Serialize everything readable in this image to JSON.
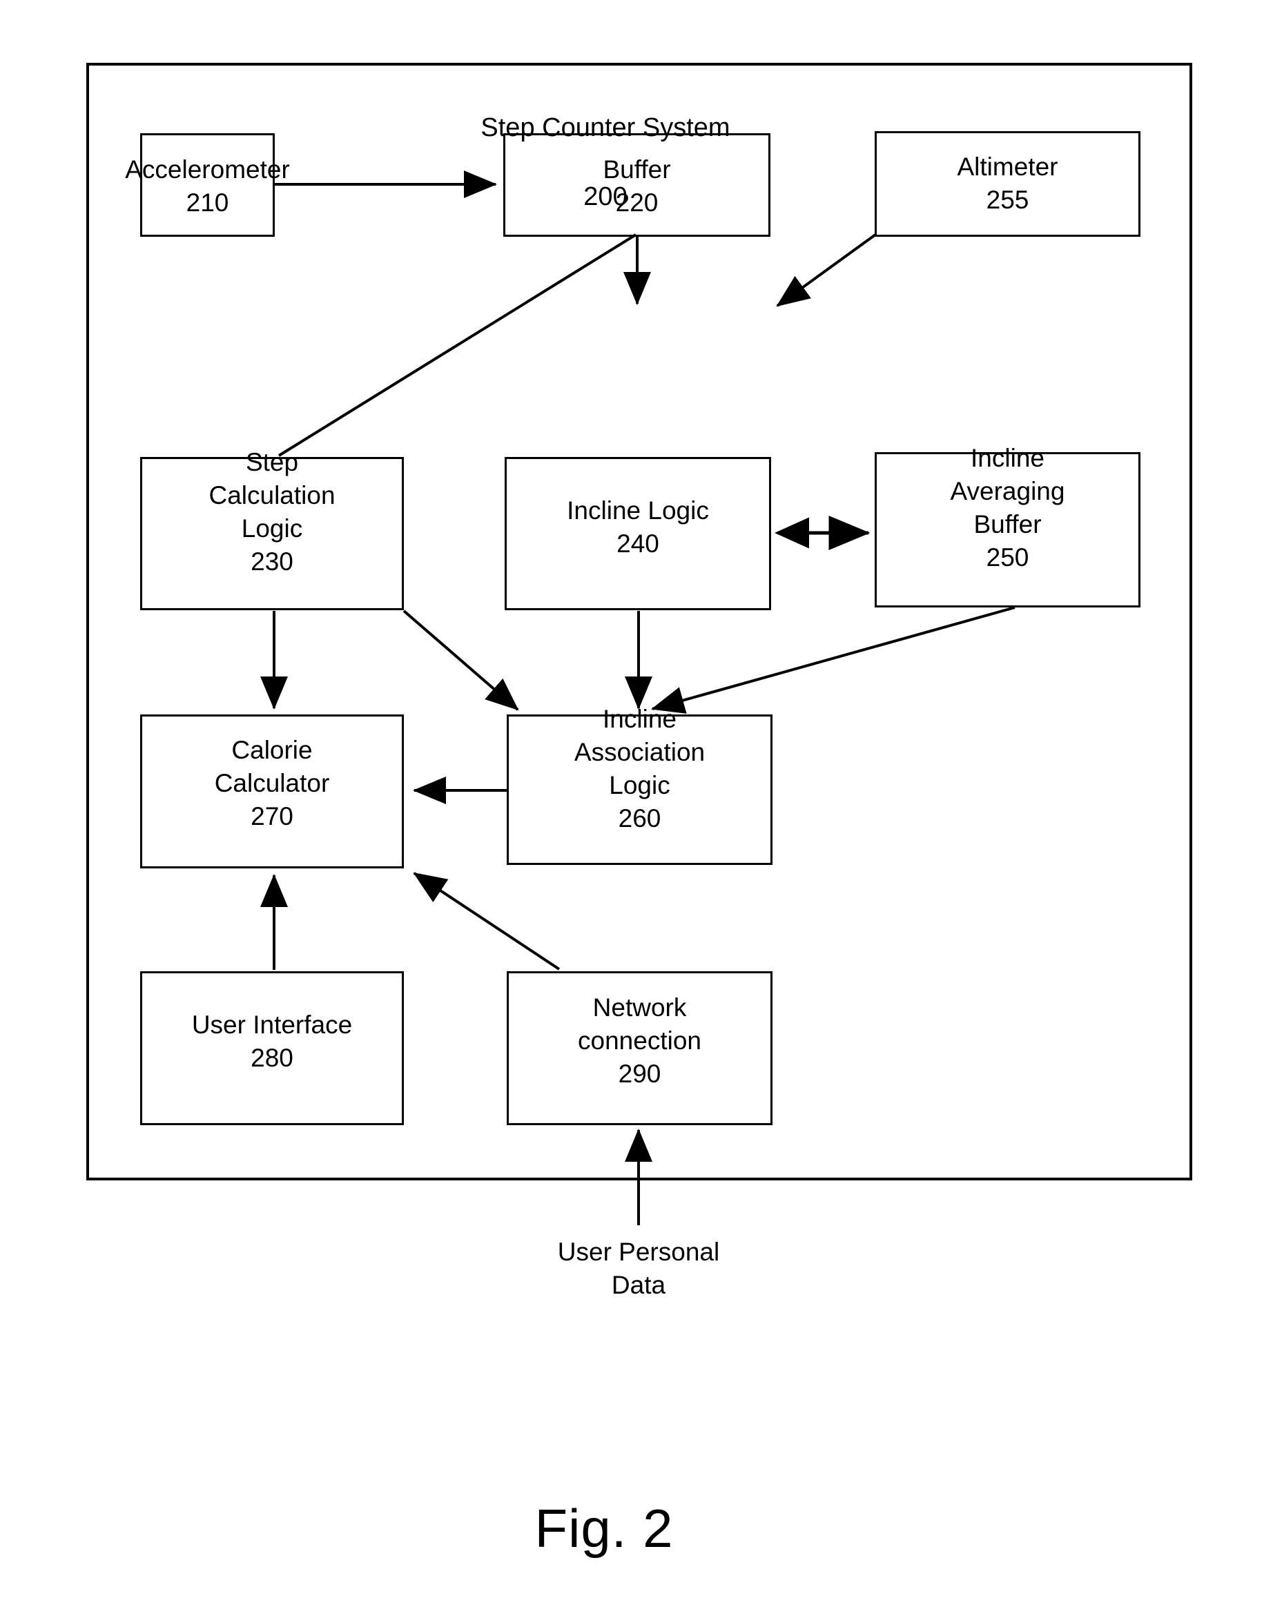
{
  "figure": {
    "caption": "Fig. 2",
    "system_title": "Step Counter System",
    "system_number": "200",
    "external_input_label": "User Personal\nData"
  },
  "nodes": [
    {
      "id": "accelerometer",
      "name": "Accelerometer",
      "number": "210",
      "label": "Accelerometer\n210"
    },
    {
      "id": "buffer",
      "name": "Buffer",
      "number": "220",
      "label": "Buffer\n220"
    },
    {
      "id": "altimeter",
      "name": "Altimeter",
      "number": "255",
      "label": "Altimeter\n255"
    },
    {
      "id": "step-calculation-logic",
      "name": "Step Calculation Logic",
      "number": "230",
      "label": "Step\nCalculation\nLogic\n230"
    },
    {
      "id": "incline-logic",
      "name": "Incline Logic",
      "number": "240",
      "label": "Incline Logic\n240"
    },
    {
      "id": "incline-averaging-buffer",
      "name": "Incline Averaging Buffer",
      "number": "250",
      "label": "Incline\nAveraging\nBuffer\n250"
    },
    {
      "id": "calorie-calculator",
      "name": "Calorie Calculator",
      "number": "270",
      "label": "Calorie\nCalculator\n270"
    },
    {
      "id": "incline-association-logic",
      "name": "Incline Association Logic",
      "number": "260",
      "label": "Incline\nAssociation\nLogic\n260"
    },
    {
      "id": "user-interface",
      "name": "User Interface",
      "number": "280",
      "label": "User Interface\n280"
    },
    {
      "id": "network-connection",
      "name": "Network connection",
      "number": "290",
      "label": "Network\nconnection\n290"
    }
  ],
  "connections": [
    {
      "from": "accelerometer",
      "to": "buffer",
      "type": "arrow"
    },
    {
      "from": "buffer",
      "to": "incline-logic",
      "type": "arrow"
    },
    {
      "from": "buffer",
      "to": "step-calculation-logic",
      "type": "line"
    },
    {
      "from": "altimeter",
      "to": "incline-logic",
      "type": "arrow"
    },
    {
      "from": "incline-logic",
      "to": "incline-averaging-buffer",
      "type": "double-arrow"
    },
    {
      "from": "step-calculation-logic",
      "to": "calorie-calculator",
      "type": "arrow"
    },
    {
      "from": "step-calculation-logic",
      "to": "incline-association-logic",
      "type": "arrow"
    },
    {
      "from": "incline-logic",
      "to": "incline-association-logic",
      "type": "arrow"
    },
    {
      "from": "incline-averaging-buffer",
      "to": "incline-association-logic",
      "type": "arrow"
    },
    {
      "from": "incline-association-logic",
      "to": "calorie-calculator",
      "type": "arrow"
    },
    {
      "from": "user-interface",
      "to": "calorie-calculator",
      "type": "arrow"
    },
    {
      "from": "network-connection",
      "to": "calorie-calculator",
      "type": "arrow"
    },
    {
      "from": "external-input",
      "to": "network-connection",
      "type": "arrow"
    }
  ],
  "colors": {
    "stroke": "#000000",
    "background": "#ffffff"
  }
}
